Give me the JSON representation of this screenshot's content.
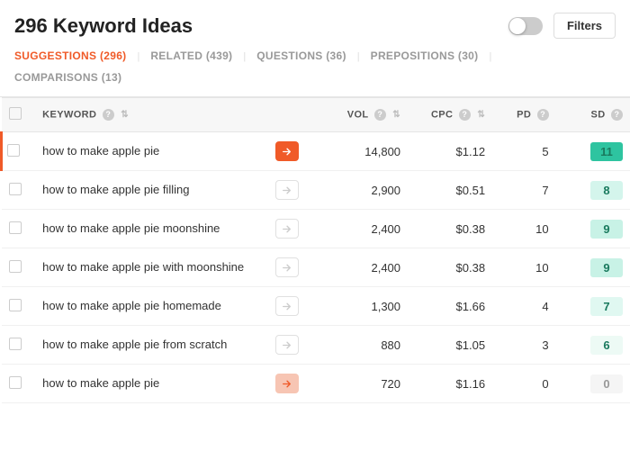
{
  "header": {
    "title": "296 Keyword Ideas",
    "filters_label": "Filters"
  },
  "tabs": [
    {
      "id": "suggestions",
      "label": "SUGGESTIONS (296)",
      "active": true
    },
    {
      "id": "related",
      "label": "RELATED (439)",
      "active": false
    },
    {
      "id": "questions",
      "label": "QUESTIONS (36)",
      "active": false
    },
    {
      "id": "prepositions",
      "label": "PREPOSITIONS (30)",
      "active": false
    },
    {
      "id": "comparisons",
      "label": "COMPARISONS (13)",
      "active": false
    }
  ],
  "table": {
    "columns": [
      {
        "id": "keyword",
        "label": "KEYWORD",
        "has_help": true,
        "has_sort": true
      },
      {
        "id": "vol",
        "label": "VOL",
        "has_help": true,
        "has_sort": true
      },
      {
        "id": "cpc",
        "label": "CPC",
        "has_help": true,
        "has_sort": true
      },
      {
        "id": "pd",
        "label": "PD",
        "has_help": true,
        "has_sort": false
      },
      {
        "id": "sd",
        "label": "SD",
        "has_help": true,
        "has_sort": false
      }
    ],
    "rows": [
      {
        "keyword": "how to make apple pie",
        "vol": "14,800",
        "cpc": "$1.12",
        "pd": "5",
        "sd": "11",
        "sd_color": "#2ec4a0",
        "highlighted": true,
        "arrow_filled": true
      },
      {
        "keyword": "how to make apple pie filling",
        "vol": "2,900",
        "cpc": "$0.51",
        "pd": "7",
        "sd": "8",
        "sd_color": "#d4f5ec",
        "highlighted": false,
        "arrow_filled": false
      },
      {
        "keyword": "how to make apple pie moonshine",
        "vol": "2,400",
        "cpc": "$0.38",
        "pd": "10",
        "sd": "9",
        "sd_color": "#c8f2e6",
        "highlighted": false,
        "arrow_filled": false
      },
      {
        "keyword": "how to make apple pie with moonshine",
        "vol": "2,400",
        "cpc": "$0.38",
        "pd": "10",
        "sd": "9",
        "sd_color": "#c8f2e6",
        "highlighted": false,
        "arrow_filled": false
      },
      {
        "keyword": "how to make apple pie homemade",
        "vol": "1,300",
        "cpc": "$1.66",
        "pd": "4",
        "sd": "7",
        "sd_color": "#e0f8f1",
        "highlighted": false,
        "arrow_filled": false
      },
      {
        "keyword": "how to make apple pie from scratch",
        "vol": "880",
        "cpc": "$1.05",
        "pd": "3",
        "sd": "6",
        "sd_color": "#edfaf5",
        "highlighted": false,
        "arrow_filled": false
      },
      {
        "keyword": "how to make apple pie",
        "vol": "720",
        "cpc": "$1.16",
        "pd": "0",
        "sd": "0",
        "sd_color": "#f5f5f5",
        "highlighted": false,
        "arrow_filled": true,
        "partial": true
      }
    ]
  }
}
